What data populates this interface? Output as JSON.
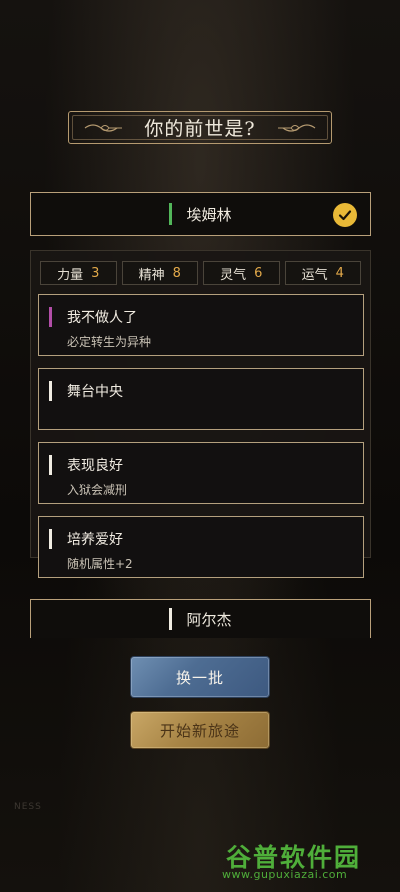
{
  "title": "你的前世是?",
  "selected_origin": {
    "name": "埃姆林",
    "bar_color": "#52b65a"
  },
  "stats": [
    {
      "label": "力量",
      "value": "3"
    },
    {
      "label": "精神",
      "value": "8"
    },
    {
      "label": "灵气",
      "value": "6"
    },
    {
      "label": "运气",
      "value": "4"
    }
  ],
  "talents": [
    {
      "title": "我不做人了",
      "desc": "必定转生为异种",
      "bar_color": "#b24ea8"
    },
    {
      "title": "舞台中央",
      "desc": "",
      "bar_color": "#f0ece2"
    },
    {
      "title": "表现良好",
      "desc": "入狱会减刑",
      "bar_color": "#f0ece2"
    },
    {
      "title": "培养爱好",
      "desc": "随机属性+2",
      "bar_color": "#f0ece2"
    }
  ],
  "next_origin": {
    "name": "阿尔杰",
    "bar_color": "#f0ece2"
  },
  "buttons": {
    "refresh": "换一批",
    "start": "开始新旅途"
  },
  "background_text": "NESS",
  "watermark": {
    "main": "谷普软件园",
    "sub": "www.gupuxiazai.com"
  }
}
